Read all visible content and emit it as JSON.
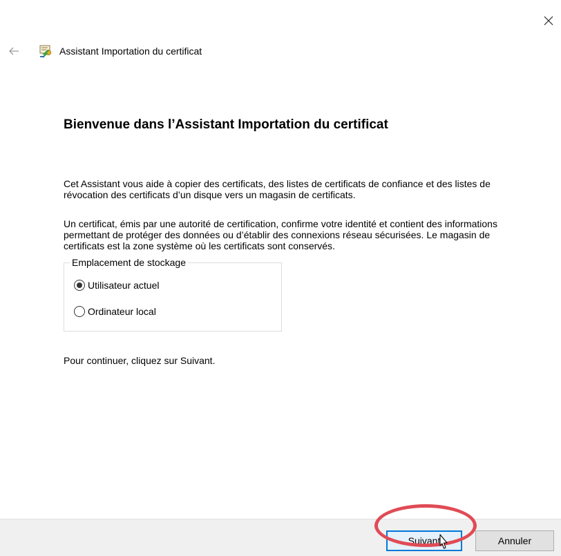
{
  "window": {
    "title": "Assistant Importation du certificat",
    "close_label": "Fermer"
  },
  "wizard": {
    "heading": "Bienvenue dans l’Assistant Importation du certificat",
    "paragraph1": "Cet Assistant vous aide à copier des certificats, des listes de certificats de confiance et des listes de révocation des certificats d’un disque vers un magasin de certificats.",
    "paragraph2": "Un certificat, émis par une autorité de certification, confirme votre identité et contient des informations permettant de protéger des données ou d’établir des connexions réseau sécurisées. Le magasin de certificats est la zone système où les certificats sont conservés.",
    "storage": {
      "legend": "Emplacement de stockage",
      "options": [
        {
          "label": "Utilisateur actuel",
          "selected": true
        },
        {
          "label": "Ordinateur local",
          "selected": false
        }
      ]
    },
    "continue_text": "Pour continuer, cliquez sur Suivant."
  },
  "footer": {
    "next_label": "Suivant",
    "cancel_label": "Annuler"
  },
  "colors": {
    "highlight": "#e04b55",
    "focus_border": "#0078d7",
    "footer_bg": "#f0f0f0"
  },
  "icons": {
    "close": "close-icon",
    "back": "back-arrow-icon",
    "app": "certificate-icon",
    "cursor": "mouse-pointer-icon"
  }
}
